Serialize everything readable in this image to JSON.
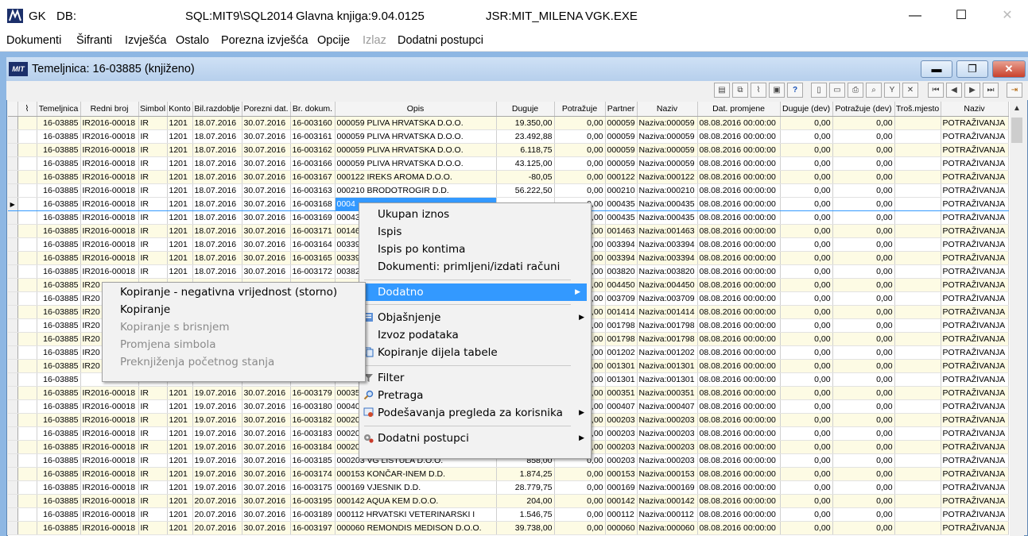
{
  "window": {
    "app": "GK",
    "db": "DB:",
    "server": "SQL:MIT9\\SQL2014",
    "version": "Glavna knjiga:9.04.0125",
    "user": "JSR:MIT_MILENA",
    "exe": "VGK.EXE",
    "minimize": "—",
    "maximize": "☐",
    "close": "✕"
  },
  "menu": [
    "Dokumenti",
    "Šifranti",
    "Izvješća",
    "Ostalo",
    "Porezna izvješća",
    "Opcije",
    "Izlaz",
    "Dodatni postupci"
  ],
  "child": {
    "logo": "MIT",
    "title": "Temeljnica: 16-03885  (knjiženo)"
  },
  "columns": [
    "Temeljnica",
    "Redni broj",
    "Simbol",
    "Konto",
    "Bil.razdoblje",
    "Porezni dat.",
    "Br. dokum.",
    "Opis",
    "Duguje",
    "Potražuje",
    "Partner",
    "Naziv",
    "Dat. promjene",
    "Duguje (dev)",
    "Potražuje (dev)",
    "Troš.mjesto",
    "Naziv"
  ],
  "rows": [
    [
      "16-03885",
      "IR2016-00018",
      "IR",
      "1201",
      "18.07.2016",
      "30.07.2016",
      "16-003160",
      "000059 PLIVA HRVATSKA D.O.O.",
      "19.350,00",
      "0,00",
      "000059",
      "Naziva:000059",
      "08.08.2016 00:00:00",
      "0,00",
      "0,00",
      "",
      "POTRAŽIVANJA"
    ],
    [
      "16-03885",
      "IR2016-00018",
      "IR",
      "1201",
      "18.07.2016",
      "30.07.2016",
      "16-003161",
      "000059 PLIVA HRVATSKA D.O.O.",
      "23.492,88",
      "0,00",
      "000059",
      "Naziva:000059",
      "08.08.2016 00:00:00",
      "0,00",
      "0,00",
      "",
      "POTRAŽIVANJA"
    ],
    [
      "16-03885",
      "IR2016-00018",
      "IR",
      "1201",
      "18.07.2016",
      "30.07.2016",
      "16-003162",
      "000059 PLIVA HRVATSKA D.O.O.",
      "6.118,75",
      "0,00",
      "000059",
      "Naziva:000059",
      "08.08.2016 00:00:00",
      "0,00",
      "0,00",
      "",
      "POTRAŽIVANJA"
    ],
    [
      "16-03885",
      "IR2016-00018",
      "IR",
      "1201",
      "18.07.2016",
      "30.07.2016",
      "16-003166",
      "000059 PLIVA HRVATSKA D.O.O.",
      "43.125,00",
      "0,00",
      "000059",
      "Naziva:000059",
      "08.08.2016 00:00:00",
      "0,00",
      "0,00",
      "",
      "POTRAŽIVANJA"
    ],
    [
      "16-03885",
      "IR2016-00018",
      "IR",
      "1201",
      "18.07.2016",
      "30.07.2016",
      "16-003167",
      "000122 IREKS AROMA D.O.O.",
      "-80,05",
      "0,00",
      "000122",
      "Naziva:000122",
      "08.08.2016 00:00:00",
      "0,00",
      "0,00",
      "",
      "POTRAŽIVANJA"
    ],
    [
      "16-03885",
      "IR2016-00018",
      "IR",
      "1201",
      "18.07.2016",
      "30.07.2016",
      "16-003163",
      "000210 BRODOTROGIR D.D.",
      "56.222,50",
      "0,00",
      "000210",
      "Naziva:000210",
      "08.08.2016 00:00:00",
      "0,00",
      "0,00",
      "",
      "POTRAŽIVANJA"
    ],
    [
      "16-03885",
      "IR2016-00018",
      "IR",
      "1201",
      "18.07.2016",
      "30.07.2016",
      "16-003168",
      "0004",
      "",
      "0,00",
      "000435",
      "Naziva:000435",
      "08.08.2016 00:00:00",
      "0,00",
      "0,00",
      "",
      "POTRAŽIVANJA"
    ],
    [
      "16-03885",
      "IR2016-00018",
      "IR",
      "1201",
      "18.07.2016",
      "30.07.2016",
      "16-003169",
      "00043",
      "",
      "0,00",
      "000435",
      "Naziva:000435",
      "08.08.2016 00:00:00",
      "0,00",
      "0,00",
      "",
      "POTRAŽIVANJA"
    ],
    [
      "16-03885",
      "IR2016-00018",
      "IR",
      "1201",
      "18.07.2016",
      "30.07.2016",
      "16-003171",
      "00146",
      "",
      "0,00",
      "001463",
      "Naziva:001463",
      "08.08.2016 00:00:00",
      "0,00",
      "0,00",
      "",
      "POTRAŽIVANJA"
    ],
    [
      "16-03885",
      "IR2016-00018",
      "IR",
      "1201",
      "18.07.2016",
      "30.07.2016",
      "16-003164",
      "00339",
      "",
      "0,00",
      "003394",
      "Naziva:003394",
      "08.08.2016 00:00:00",
      "0,00",
      "0,00",
      "",
      "POTRAŽIVANJA"
    ],
    [
      "16-03885",
      "IR2016-00018",
      "IR",
      "1201",
      "18.07.2016",
      "30.07.2016",
      "16-003165",
      "00339",
      "",
      "0,00",
      "003394",
      "Naziva:003394",
      "08.08.2016 00:00:00",
      "0,00",
      "0,00",
      "",
      "POTRAŽIVANJA"
    ],
    [
      "16-03885",
      "IR2016-00018",
      "IR",
      "1201",
      "18.07.2016",
      "30.07.2016",
      "16-003172",
      "00382",
      "",
      "0,00",
      "003820",
      "Naziva:003820",
      "08.08.2016 00:00:00",
      "0,00",
      "0,00",
      "",
      "POTRAŽIVANJA"
    ],
    [
      "16-03885",
      "IR20",
      "",
      "",
      "",
      "",
      "",
      "",
      "",
      "0,00",
      "004450",
      "Naziva:004450",
      "08.08.2016 00:00:00",
      "0,00",
      "0,00",
      "",
      "POTRAŽIVANJA"
    ],
    [
      "16-03885",
      "IR20",
      "",
      "",
      "",
      "",
      "",
      "",
      "",
      "0,00",
      "003709",
      "Naziva:003709",
      "08.08.2016 00:00:00",
      "0,00",
      "0,00",
      "",
      "POTRAŽIVANJA"
    ],
    [
      "16-03885",
      "IR20",
      "",
      "",
      "",
      "",
      "",
      "",
      "",
      "0,00",
      "001414",
      "Naziva:001414",
      "08.08.2016 00:00:00",
      "0,00",
      "0,00",
      "",
      "POTRAŽIVANJA"
    ],
    [
      "16-03885",
      "IR20",
      "",
      "",
      "",
      "",
      "",
      "",
      "",
      "0,00",
      "001798",
      "Naziva:001798",
      "08.08.2016 00:00:00",
      "0,00",
      "0,00",
      "",
      "POTRAŽIVANJA"
    ],
    [
      "16-03885",
      "IR20",
      "",
      "",
      "",
      "",
      "",
      "",
      "",
      "0,00",
      "001798",
      "Naziva:001798",
      "08.08.2016 00:00:00",
      "0,00",
      "0,00",
      "",
      "POTRAŽIVANJA"
    ],
    [
      "16-03885",
      "IR20",
      "",
      "",
      "",
      "",
      "",
      "",
      "",
      "0,00",
      "001202",
      "Naziva:001202",
      "08.08.2016 00:00:00",
      "0,00",
      "0,00",
      "",
      "POTRAŽIVANJA"
    ],
    [
      "16-03885",
      "IR20",
      "",
      "",
      "",
      "",
      "",
      "",
      "",
      "0,00",
      "001301",
      "Naziva:001301",
      "08.08.2016 00:00:00",
      "0,00",
      "0,00",
      "",
      "POTRAŽIVANJA"
    ],
    [
      "16-03885",
      "",
      "",
      "",
      "",
      "",
      "",
      "",
      "",
      "0,00",
      "001301",
      "Naziva:001301",
      "08.08.2016 00:00:00",
      "0,00",
      "0,00",
      "",
      "POTRAŽIVANJA"
    ],
    [
      "16-03885",
      "IR2016-00018",
      "IR",
      "1201",
      "19.07.2016",
      "30.07.2016",
      "16-003179",
      "00035",
      "",
      "0,00",
      "000351",
      "Naziva:000351",
      "08.08.2016 00:00:00",
      "0,00",
      "0,00",
      "",
      "POTRAŽIVANJA"
    ],
    [
      "16-03885",
      "IR2016-00018",
      "IR",
      "1201",
      "19.07.2016",
      "30.07.2016",
      "16-003180",
      "00040",
      "",
      "0,00",
      "000407",
      "Naziva:000407",
      "08.08.2016 00:00:00",
      "0,00",
      "0,00",
      "",
      "POTRAŽIVANJA"
    ],
    [
      "16-03885",
      "IR2016-00018",
      "IR",
      "1201",
      "19.07.2016",
      "30.07.2016",
      "16-003182",
      "00020",
      "",
      "0,00",
      "000203",
      "Naziva:000203",
      "08.08.2016 00:00:00",
      "0,00",
      "0,00",
      "",
      "POTRAŽIVANJA"
    ],
    [
      "16-03885",
      "IR2016-00018",
      "IR",
      "1201",
      "19.07.2016",
      "30.07.2016",
      "16-003183",
      "00020",
      "",
      "0,00",
      "000203",
      "Naziva:000203",
      "08.08.2016 00:00:00",
      "0,00",
      "0,00",
      "",
      "POTRAŽIVANJA"
    ],
    [
      "16-03885",
      "IR2016-00018",
      "IR",
      "1201",
      "19.07.2016",
      "30.07.2016",
      "16-003184",
      "00020",
      "",
      "0,00",
      "000203",
      "Naziva:000203",
      "08.08.2016 00:00:00",
      "0,00",
      "0,00",
      "",
      "POTRAŽIVANJA"
    ],
    [
      "16-03885",
      "IR2016-00018",
      "IR",
      "1201",
      "19.07.2016",
      "30.07.2016",
      "16-003185",
      "000203 VG LISTULA D.O.O.",
      "858,00",
      "0,00",
      "000203",
      "Naziva:000203",
      "08.08.2016 00:00:00",
      "0,00",
      "0,00",
      "",
      "POTRAŽIVANJA"
    ],
    [
      "16-03885",
      "IR2016-00018",
      "IR",
      "1201",
      "19.07.2016",
      "30.07.2016",
      "16-003174",
      "000153 KONČAR-INEM D.D.",
      "1.874,25",
      "0,00",
      "000153",
      "Naziva:000153",
      "08.08.2016 00:00:00",
      "0,00",
      "0,00",
      "",
      "POTRAŽIVANJA"
    ],
    [
      "16-03885",
      "IR2016-00018",
      "IR",
      "1201",
      "19.07.2016",
      "30.07.2016",
      "16-003175",
      "000169 VJESNIK D.D.",
      "28.779,75",
      "0,00",
      "000169",
      "Naziva:000169",
      "08.08.2016 00:00:00",
      "0,00",
      "0,00",
      "",
      "POTRAŽIVANJA"
    ],
    [
      "16-03885",
      "IR2016-00018",
      "IR",
      "1201",
      "20.07.2016",
      "30.07.2016",
      "16-003195",
      "000142 AQUA KEM D.O.O.",
      "204,00",
      "0,00",
      "000142",
      "Naziva:000142",
      "08.08.2016 00:00:00",
      "0,00",
      "0,00",
      "",
      "POTRAŽIVANJA"
    ],
    [
      "16-03885",
      "IR2016-00018",
      "IR",
      "1201",
      "20.07.2016",
      "30.07.2016",
      "16-003189",
      "000112 HRVATSKI VETERINARSKI I",
      "1.546,75",
      "0,00",
      "000112",
      "Naziva:000112",
      "08.08.2016 00:00:00",
      "0,00",
      "0,00",
      "",
      "POTRAŽIVANJA"
    ],
    [
      "16-03885",
      "IR2016-00018",
      "IR",
      "1201",
      "20.07.2016",
      "30.07.2016",
      "16-003197",
      "000060 REMONDIS MEDISON D.O.O.",
      "39.738,00",
      "0,00",
      "000060",
      "Naziva:000060",
      "08.08.2016 00:00:00",
      "0,00",
      "0,00",
      "",
      "POTRAŽIVANJA"
    ]
  ],
  "selected_row": 6,
  "context_menu": {
    "items": [
      "Ukupan iznos",
      "Ispis",
      "Ispis po kontima",
      "Dokumenti: primljeni/izdati računi",
      "Dodatno",
      "Objašnjenje",
      "Izvoz podataka",
      "Kopiranje dijela tabele",
      "Filter",
      "Pretraga",
      "Podešavanja pregleda za korisnika",
      "Dodatni postupci"
    ]
  },
  "submenu": {
    "items": [
      "Kopiranje - negativna vrijednost (storno)",
      "Kopiranje",
      "Kopiranje s brisnjem",
      "Promjena simbola",
      "Preknjiženja početnog stanja"
    ]
  }
}
